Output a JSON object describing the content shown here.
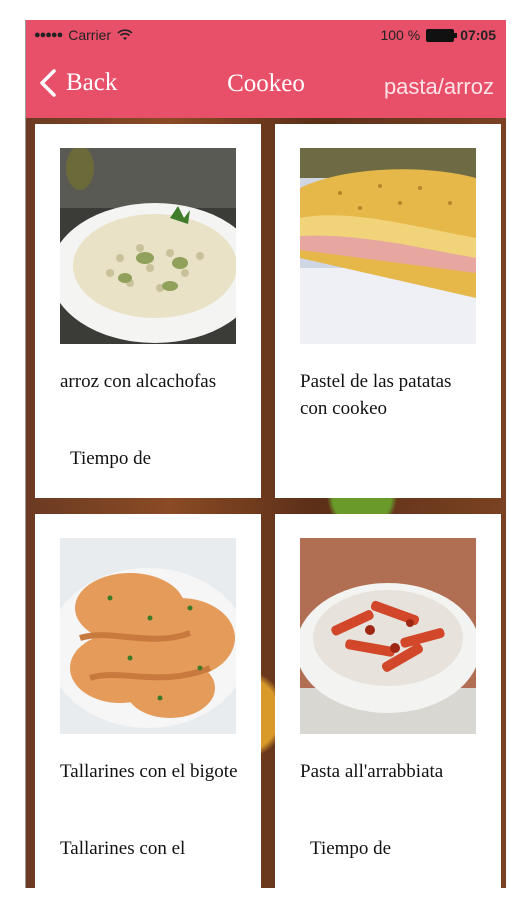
{
  "status_bar": {
    "carrier": "Carrier",
    "signal_dots": "●●●●●",
    "battery": "100 %",
    "time": "07:05",
    "wifi_icon": "wifi-icon",
    "battery_icon": "battery-icon"
  },
  "nav": {
    "back_label": "Back",
    "title": "Cookeo",
    "category": "pasta/arroz",
    "back_icon": "chevron-left-icon",
    "color": "#e8506a"
  },
  "recipes": [
    {
      "name": "arroz con alcachofas",
      "time_label": "Tiempo de"
    },
    {
      "name": "Pastel de las patatas con cookeo",
      "time_label": ""
    },
    {
      "name": "Tallarines con el bigote",
      "time_label": "Tallarines con el"
    },
    {
      "name": "Pasta all'arrabbiata",
      "time_label": "Tiempo de"
    }
  ]
}
